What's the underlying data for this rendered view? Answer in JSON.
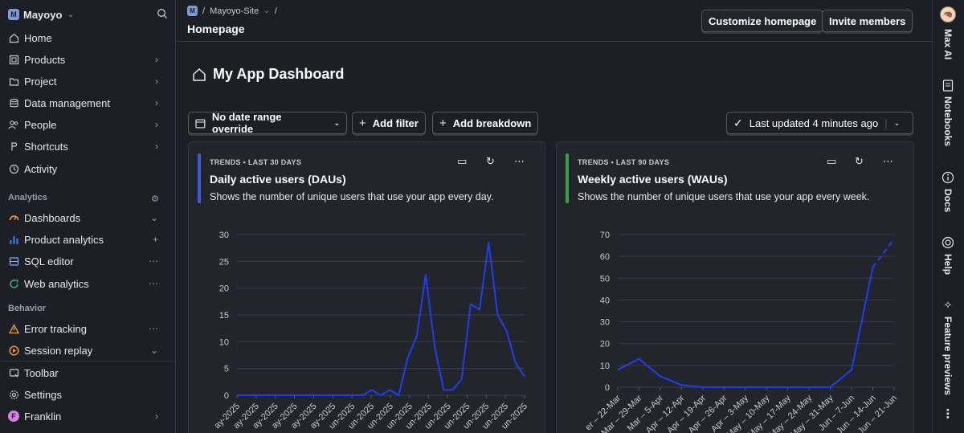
{
  "sidebar": {
    "workspace": {
      "badge": "M",
      "name": "Mayoyo"
    },
    "items": [
      {
        "label": "Home"
      },
      {
        "label": "Products"
      },
      {
        "label": "Project"
      },
      {
        "label": "Data management"
      },
      {
        "label": "People"
      },
      {
        "label": "Shortcuts"
      },
      {
        "label": "Activity"
      }
    ],
    "analytics_header": "Analytics",
    "analytics": [
      {
        "label": "Dashboards"
      },
      {
        "label": "Product analytics"
      },
      {
        "label": "SQL editor"
      },
      {
        "label": "Web analytics"
      }
    ],
    "behavior_header": "Behavior",
    "behavior": [
      {
        "label": "Error tracking"
      },
      {
        "label": "Session replay"
      }
    ],
    "bottom": [
      {
        "label": "Toolbar"
      },
      {
        "label": "Settings"
      },
      {
        "label": "Franklin",
        "avatar": "F"
      }
    ]
  },
  "header": {
    "breadcrumb_badge": "M",
    "breadcrumb_project": "Mayoyo-Site",
    "title": "Homepage",
    "customize_label": "Customize homepage",
    "invite_label": "Invite members"
  },
  "rail": {
    "items": [
      {
        "label": "Max AI",
        "icon": "max-ai-icon"
      },
      {
        "label": "Notebooks",
        "icon": "notebook-icon"
      },
      {
        "label": "Docs",
        "icon": "info-icon"
      },
      {
        "label": "Help",
        "icon": "lifebuoy-icon"
      },
      {
        "label": "Feature previews",
        "icon": "sparkle-icon"
      }
    ],
    "more": "⋯"
  },
  "dashboard": {
    "title": "My App Dashboard",
    "date_range_label": "No date range override",
    "add_filter_label": "Add filter",
    "add_breakdown_label": "Add breakdown",
    "last_updated_label": "Last updated 4 minutes ago"
  },
  "cards": [
    {
      "kicker": "TRENDS • LAST 30 DAYS",
      "title": "Daily active users (DAUs)",
      "description": "Shows the number of unique users that use your app every day.",
      "accent_color": "#3b5bdb"
    },
    {
      "kicker": "TRENDS • LAST 90 DAYS",
      "title": "Weekly active users (WAUs)",
      "description": "Shows the number of unique users that use your app every week.",
      "accent_color": "#3aa34a"
    }
  ],
  "chart_data": [
    {
      "type": "line",
      "series_color": "#1f3ef0",
      "ylim": [
        0,
        30
      ],
      "yticks": [
        0,
        5,
        10,
        15,
        20,
        25,
        30
      ],
      "x": [
        "ay-2025",
        "ay-2025",
        "ay-2025",
        "ay-2025",
        "ay-2025",
        "ay-2025",
        "un-2025",
        "un-2025",
        "un-2025",
        "un-2025",
        "un-2025",
        "un-2025",
        "un-2025",
        "un-2025",
        "un-2025",
        "un-2025"
      ],
      "values": [
        0,
        0,
        0,
        0,
        0,
        0,
        0,
        0,
        0,
        0,
        0,
        0,
        0,
        0,
        0,
        1,
        0,
        1,
        0,
        7,
        11,
        22.5,
        9,
        1,
        1,
        3,
        17,
        16,
        28.5,
        15,
        12,
        6,
        3.5
      ],
      "grid": true
    },
    {
      "type": "line",
      "series_color": "#1f3ef0",
      "ylim": [
        0,
        70
      ],
      "yticks": [
        0,
        10,
        20,
        30,
        40,
        50,
        60,
        70
      ],
      "x": [
        "er – 22-Mar",
        "Mar – 29-Mar",
        "Mar – 5-Apr",
        "Apr – 12-Apr",
        "Apr – 19-Apr",
        "Apr – 26-Apr",
        "Apr – 3-May",
        "May – 10-May",
        "May – 17-May",
        "May – 24-May",
        "May – 31-May",
        "Jun – 7-Jun",
        "Jun – 14-Jun",
        "Jun – 21-Jun"
      ],
      "values": [
        8,
        13,
        5,
        1,
        0,
        0,
        0,
        0,
        0,
        0,
        0,
        8,
        55,
        68
      ],
      "dashed_last": 1,
      "grid": true
    }
  ]
}
